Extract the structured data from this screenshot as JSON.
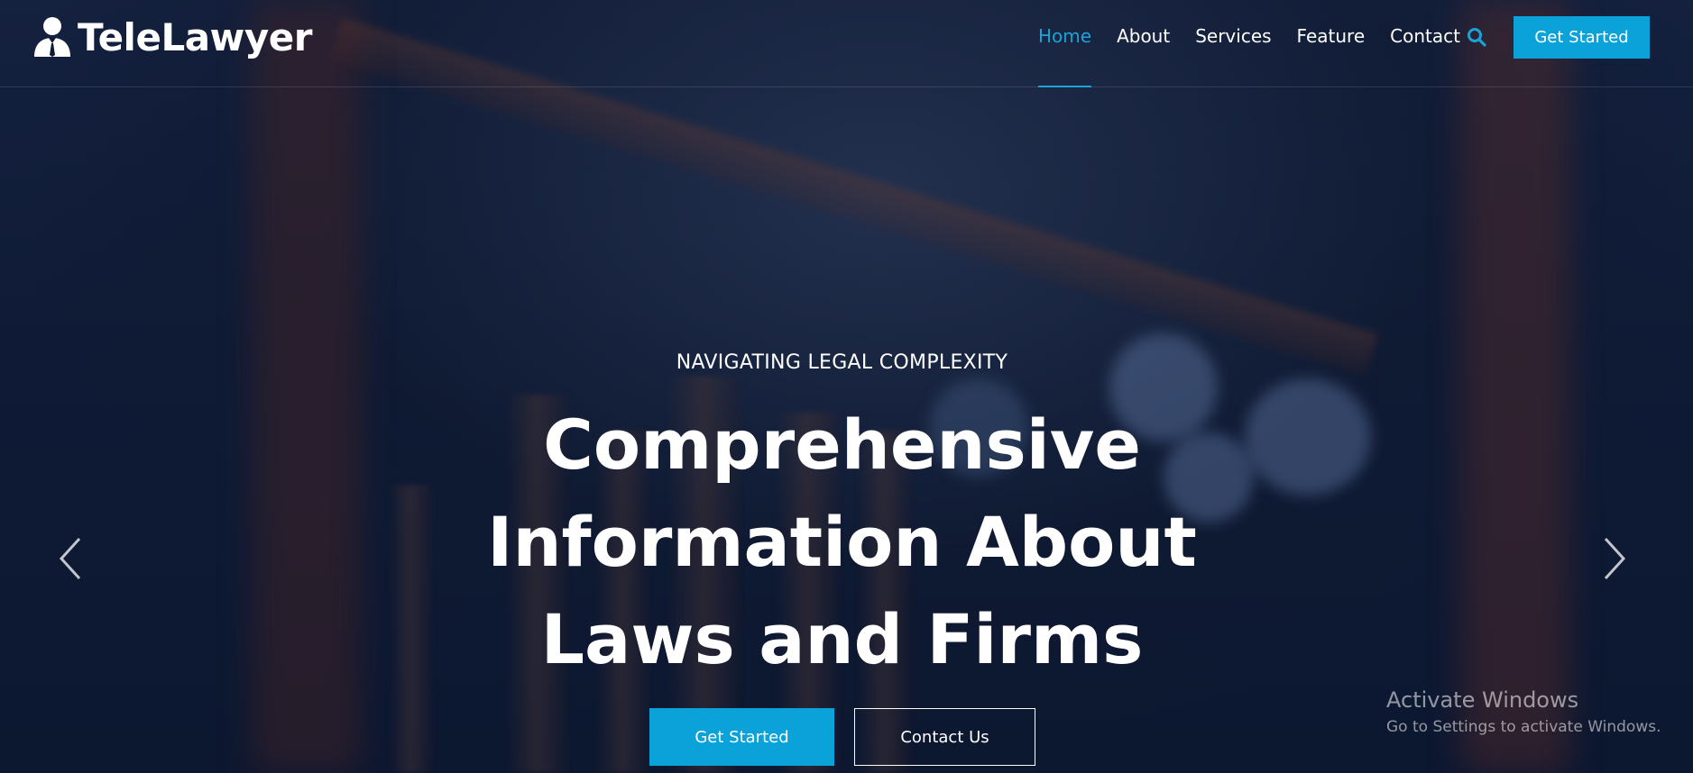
{
  "brand": {
    "name": "TeleLawyer",
    "icon": "lawyer-person-icon"
  },
  "nav": {
    "items": [
      {
        "label": "Home",
        "active": true
      },
      {
        "label": "About",
        "active": false
      },
      {
        "label": "Services",
        "active": false
      },
      {
        "label": "Feature",
        "active": false
      },
      {
        "label": "Contact",
        "active": false
      }
    ],
    "search_icon": "search-icon",
    "cta_label": "Get Started"
  },
  "hero": {
    "eyebrow": "NAVIGATING LEGAL COMPLEXITY",
    "title_lines": [
      "Comprehensive",
      "Information About",
      "Laws and Firms"
    ],
    "primary_button": "Get Started",
    "secondary_button": "Contact Us",
    "prev_icon": "chevron-left-icon",
    "next_icon": "chevron-right-icon"
  },
  "watermark": {
    "title": "Activate Windows",
    "subtitle": "Go to Settings to activate Windows."
  },
  "colors": {
    "accent": "#0aa2d9",
    "background": "#0f1b36",
    "text": "#ffffff"
  }
}
